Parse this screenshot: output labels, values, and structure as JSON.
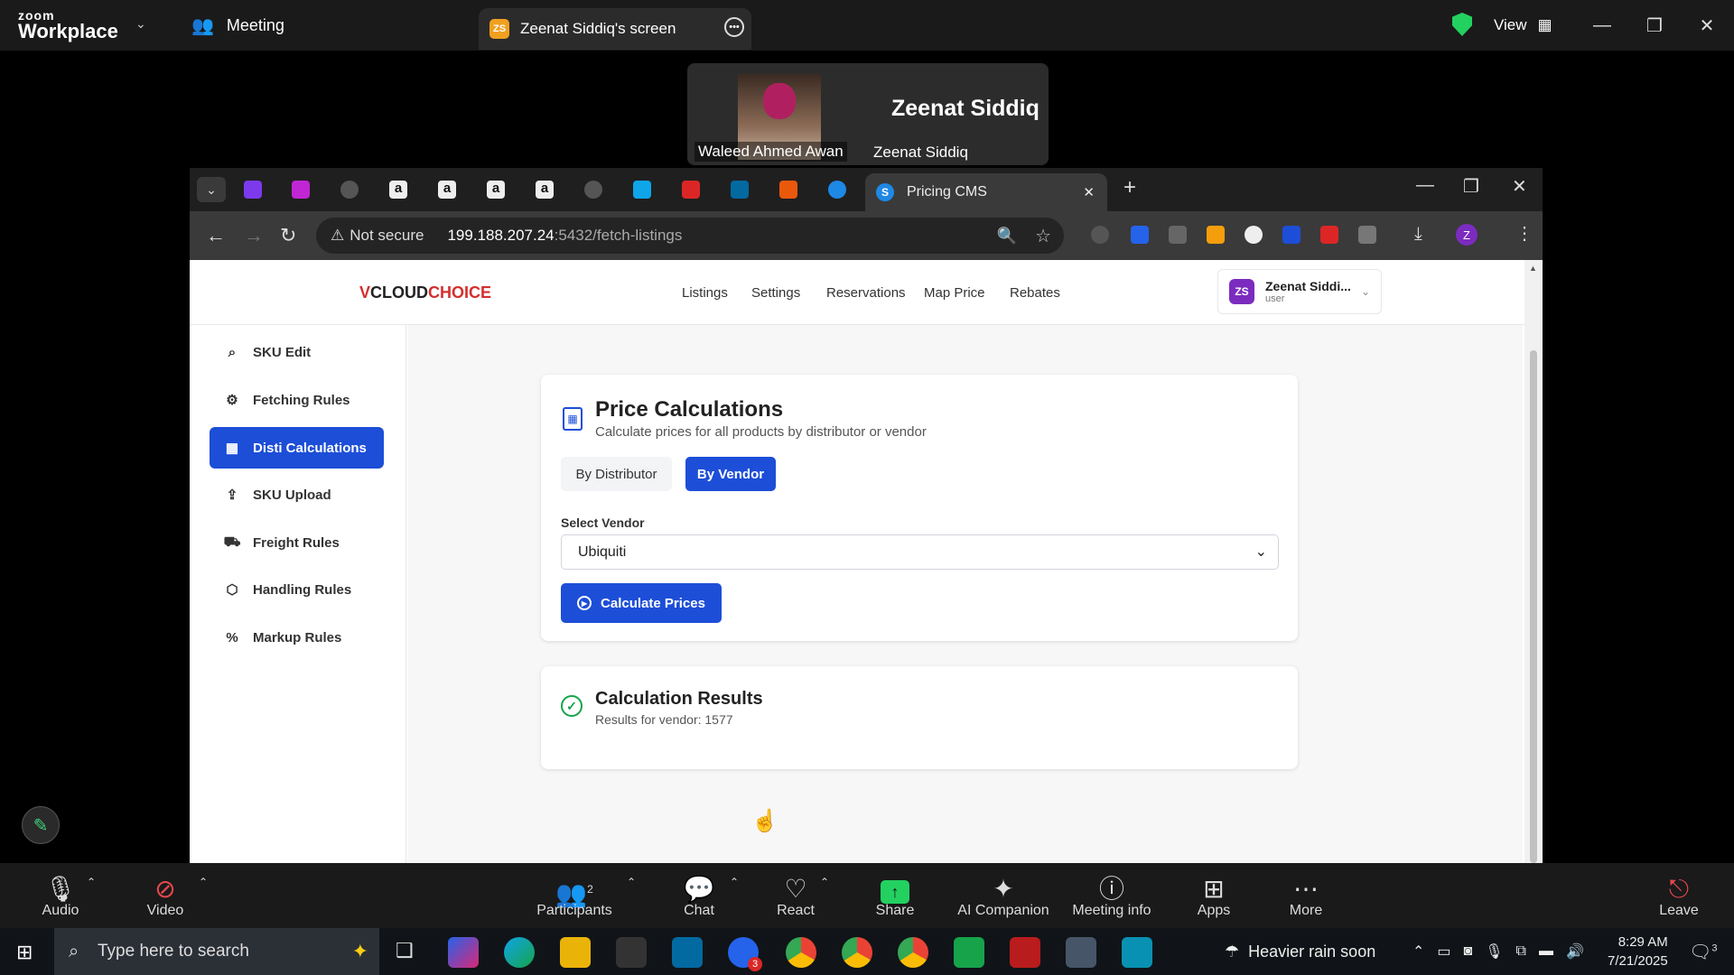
{
  "zoom": {
    "brand_top": "zoom",
    "brand_bottom": "Workplace",
    "meeting_label": "Meeting",
    "share_tab_badge": "ZS",
    "share_tab_label": "Zeenat Siddiq's screen",
    "view_label": "View",
    "thumb": {
      "big_name": "Zeenat Siddiq",
      "name1": "Waleed Ahmed Awan",
      "name2": "Zeenat Siddiq"
    },
    "controls": [
      {
        "label": "Audio",
        "icon": "mic-icon"
      },
      {
        "label": "Video",
        "icon": "video-off-icon"
      },
      {
        "label": "Participants",
        "icon": "participants-icon",
        "count": "2"
      },
      {
        "label": "Chat",
        "icon": "chat-icon"
      },
      {
        "label": "React",
        "icon": "heart-icon"
      },
      {
        "label": "Share",
        "icon": "share-icon"
      },
      {
        "label": "AI Companion",
        "icon": "sparkle-icon"
      },
      {
        "label": "Meeting info",
        "icon": "info-icon"
      },
      {
        "label": "Apps",
        "icon": "apps-icon"
      },
      {
        "label": "More",
        "icon": "more-icon"
      },
      {
        "label": "Leave",
        "icon": "leave-icon"
      }
    ]
  },
  "browser": {
    "active_tab": "Pricing CMS",
    "not_secure": "Not secure",
    "url_host": "199.188.207.24",
    "url_path": ":5432/fetch-listings",
    "profile_initial": "Z"
  },
  "app": {
    "logo_v": "V",
    "logo_cloud": "CLOUD",
    "logo_choice": "CHOICE",
    "nav": [
      "Listings",
      "Settings",
      "Reservations",
      "Map Price",
      "Rebates"
    ],
    "user": {
      "initials": "ZS",
      "name": "Zeenat Siddi...",
      "role": "user"
    },
    "sidebar": [
      {
        "label": "SKU Edit",
        "icon": "search-icon"
      },
      {
        "label": "Fetching Rules",
        "icon": "gear-icon"
      },
      {
        "label": "Disti Calculations",
        "icon": "calculator-icon"
      },
      {
        "label": "SKU Upload",
        "icon": "upload-icon"
      },
      {
        "label": "Freight Rules",
        "icon": "truck-icon"
      },
      {
        "label": "Handling Rules",
        "icon": "box-icon"
      },
      {
        "label": "Markup Rules",
        "icon": "percent-icon"
      }
    ],
    "active_sidebar": "Disti Calculations",
    "price_card": {
      "title": "Price Calculations",
      "subtitle": "Calculate prices for all products by distributor or vendor",
      "toggle_distributor": "By Distributor",
      "toggle_vendor": "By Vendor",
      "select_label": "Select Vendor",
      "select_value": "Ubiquiti",
      "calc_button": "Calculate Prices"
    },
    "results_card": {
      "title": "Calculation Results",
      "subtitle": "Results for vendor: 1577"
    }
  },
  "taskbar": {
    "search_placeholder": "Type here to search",
    "weather": "Heavier rain soon",
    "time": "8:29 AM",
    "date": "7/21/2025",
    "notif_count": "3",
    "outlook_badge": "3"
  },
  "colors": {
    "primary": "#1d4ed8",
    "success": "#16a34a",
    "zoom_green": "#23d160"
  }
}
